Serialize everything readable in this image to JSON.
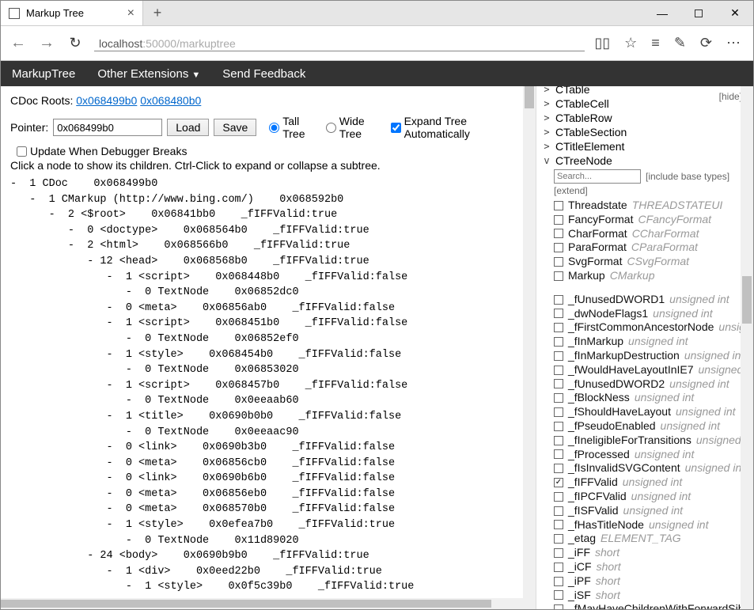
{
  "tab_title": "Markup Tree",
  "url_host": "localhost",
  "url_port_path": ":50000/markuptree",
  "menu": {
    "item1": "MarkupTree",
    "item2": "Other Extensions",
    "item3": "Send Feedback"
  },
  "cdoc_label": "CDoc Roots:",
  "cdoc_link1": "0x068499b0",
  "cdoc_link2": "0x068480b0",
  "pointer_label": "Pointer:",
  "pointer_value": "0x068499b0",
  "load_btn": "Load",
  "save_btn": "Save",
  "tall_tree": "Tall Tree",
  "wide_tree": "Wide Tree",
  "expand_auto": "Expand Tree Automatically",
  "update_break": "Update When Debugger Breaks",
  "hint": "Click a node to show its children. Ctrl-Click to expand or collapse a subtree.",
  "hide_label": "[hide]",
  "search_placeholder": "Search...",
  "include_base": "[include base types]",
  "extend_label": "[extend]",
  "tree_lines": [
    "-  1 CDoc    0x068499b0",
    "   -  1 CMarkup (http://www.bing.com/)    0x068592b0",
    "      -  2 <$root>    0x06841bb0    _fIFFValid:true",
    "         -  0 <doctype>    0x068564b0    _fIFFValid:true",
    "         -  2 <html>    0x068566b0    _fIFFValid:true",
    "            - 12 <head>    0x068568b0    _fIFFValid:true",
    "               -  1 <script>    0x068448b0    _fIFFValid:false",
    "                  -  0 TextNode    0x06852dc0",
    "               -  0 <meta>    0x06856ab0    _fIFFValid:false",
    "               -  1 <script>    0x068451b0    _fIFFValid:false",
    "                  -  0 TextNode    0x06852ef0",
    "               -  1 <style>    0x068454b0    _fIFFValid:false",
    "                  -  0 TextNode    0x06853020",
    "               -  1 <script>    0x068457b0    _fIFFValid:false",
    "                  -  0 TextNode    0x0eeaab60",
    "               -  1 <title>    0x0690b0b0    _fIFFValid:false",
    "                  -  0 TextNode    0x0eeaac90",
    "               -  0 <link>    0x0690b3b0    _fIFFValid:false",
    "               -  0 <meta>    0x06856cb0    _fIFFValid:false",
    "               -  0 <link>    0x0690b6b0    _fIFFValid:false",
    "               -  0 <meta>    0x06856eb0    _fIFFValid:false",
    "               -  0 <meta>    0x068570b0    _fIFFValid:false",
    "               -  1 <style>    0x0efea7b0    _fIFFValid:true",
    "                  -  0 TextNode    0x11d89020",
    "            - 24 <body>    0x0690b9b0    _fIFFValid:true",
    "               -  1 <div>    0x0eed22b0    _fIFFValid:true",
    "                  -  1 <style>    0x0f5c39b0    _fIFFValid:true"
  ],
  "types": [
    {
      "name": "CTable",
      "open": false,
      "clip": true
    },
    {
      "name": "CTableCell",
      "open": false
    },
    {
      "name": "CTableRow",
      "open": false
    },
    {
      "name": "CTableSection",
      "open": false
    },
    {
      "name": "CTitleElement",
      "open": false
    },
    {
      "name": "CTreeNode",
      "open": true
    }
  ],
  "props_top": [
    {
      "name": "Threadstate",
      "type": "THREADSTATEUI",
      "checked": false
    },
    {
      "name": "FancyFormat",
      "type": "CFancyFormat",
      "checked": false
    },
    {
      "name": "CharFormat",
      "type": "CCharFormat",
      "checked": false
    },
    {
      "name": "ParaFormat",
      "type": "CParaFormat",
      "checked": false
    },
    {
      "name": "SvgFormat",
      "type": "CSvgFormat",
      "checked": false
    },
    {
      "name": "Markup",
      "type": "CMarkup",
      "checked": false
    }
  ],
  "props_bottom": [
    {
      "name": "_fUnusedDWORD1",
      "type": "unsigned int",
      "checked": false
    },
    {
      "name": "_dwNodeFlags1",
      "type": "unsigned int",
      "checked": false
    },
    {
      "name": "_fFirstCommonAncestorNode",
      "type": "unsig...",
      "checked": false
    },
    {
      "name": "_fInMarkup",
      "type": "unsigned int",
      "checked": false
    },
    {
      "name": "_fInMarkupDestruction",
      "type": "unsigned int",
      "checked": false
    },
    {
      "name": "_fWouldHaveLayoutInIE7",
      "type": "unsigned int",
      "checked": false
    },
    {
      "name": "_fUnusedDWORD2",
      "type": "unsigned int",
      "checked": false
    },
    {
      "name": "_fBlockNess",
      "type": "unsigned int",
      "checked": false
    },
    {
      "name": "_fShouldHaveLayout",
      "type": "unsigned int",
      "checked": false
    },
    {
      "name": "_fPseudoEnabled",
      "type": "unsigned int",
      "checked": false
    },
    {
      "name": "_fIneligibleForTransitions",
      "type": "unsigned int",
      "checked": false
    },
    {
      "name": "_fProcessed",
      "type": "unsigned int",
      "checked": false
    },
    {
      "name": "_fIsInvalidSVGContent",
      "type": "unsigned int",
      "checked": false
    },
    {
      "name": "_fIFFValid",
      "type": "unsigned int",
      "checked": true
    },
    {
      "name": "_fIPCFValid",
      "type": "unsigned int",
      "checked": false
    },
    {
      "name": "_fISFValid",
      "type": "unsigned int",
      "checked": false
    },
    {
      "name": "_fHasTitleNode",
      "type": "unsigned int",
      "checked": false
    },
    {
      "name": "_etag",
      "type": "ELEMENT_TAG",
      "checked": false
    },
    {
      "name": "_iFF",
      "type": "short",
      "checked": false
    },
    {
      "name": "_iCF",
      "type": "short",
      "checked": false
    },
    {
      "name": "_iPF",
      "type": "short",
      "checked": false
    },
    {
      "name": "_iSF",
      "type": "short",
      "checked": false
    },
    {
      "name": "_fMayHaveChildrenWithForwardSibl...",
      "type": "",
      "checked": false
    }
  ]
}
